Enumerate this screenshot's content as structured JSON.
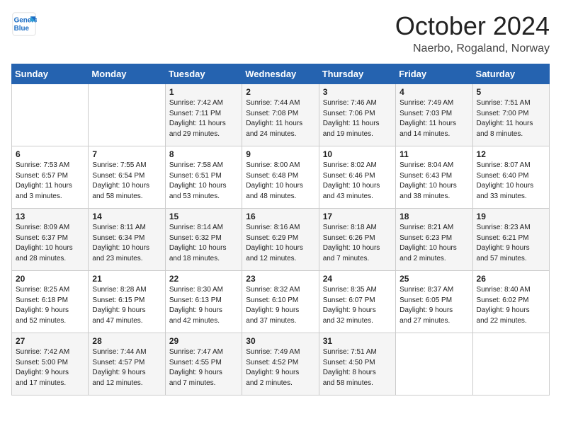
{
  "logo": {
    "line1": "General",
    "line2": "Blue"
  },
  "title": "October 2024",
  "subtitle": "Naerbo, Rogaland, Norway",
  "days_of_week": [
    "Sunday",
    "Monday",
    "Tuesday",
    "Wednesday",
    "Thursday",
    "Friday",
    "Saturday"
  ],
  "weeks": [
    [
      {
        "day": "",
        "detail": ""
      },
      {
        "day": "",
        "detail": ""
      },
      {
        "day": "1",
        "detail": "Sunrise: 7:42 AM\nSunset: 7:11 PM\nDaylight: 11 hours\nand 29 minutes."
      },
      {
        "day": "2",
        "detail": "Sunrise: 7:44 AM\nSunset: 7:08 PM\nDaylight: 11 hours\nand 24 minutes."
      },
      {
        "day": "3",
        "detail": "Sunrise: 7:46 AM\nSunset: 7:06 PM\nDaylight: 11 hours\nand 19 minutes."
      },
      {
        "day": "4",
        "detail": "Sunrise: 7:49 AM\nSunset: 7:03 PM\nDaylight: 11 hours\nand 14 minutes."
      },
      {
        "day": "5",
        "detail": "Sunrise: 7:51 AM\nSunset: 7:00 PM\nDaylight: 11 hours\nand 8 minutes."
      }
    ],
    [
      {
        "day": "6",
        "detail": "Sunrise: 7:53 AM\nSunset: 6:57 PM\nDaylight: 11 hours\nand 3 minutes."
      },
      {
        "day": "7",
        "detail": "Sunrise: 7:55 AM\nSunset: 6:54 PM\nDaylight: 10 hours\nand 58 minutes."
      },
      {
        "day": "8",
        "detail": "Sunrise: 7:58 AM\nSunset: 6:51 PM\nDaylight: 10 hours\nand 53 minutes."
      },
      {
        "day": "9",
        "detail": "Sunrise: 8:00 AM\nSunset: 6:48 PM\nDaylight: 10 hours\nand 48 minutes."
      },
      {
        "day": "10",
        "detail": "Sunrise: 8:02 AM\nSunset: 6:46 PM\nDaylight: 10 hours\nand 43 minutes."
      },
      {
        "day": "11",
        "detail": "Sunrise: 8:04 AM\nSunset: 6:43 PM\nDaylight: 10 hours\nand 38 minutes."
      },
      {
        "day": "12",
        "detail": "Sunrise: 8:07 AM\nSunset: 6:40 PM\nDaylight: 10 hours\nand 33 minutes."
      }
    ],
    [
      {
        "day": "13",
        "detail": "Sunrise: 8:09 AM\nSunset: 6:37 PM\nDaylight: 10 hours\nand 28 minutes."
      },
      {
        "day": "14",
        "detail": "Sunrise: 8:11 AM\nSunset: 6:34 PM\nDaylight: 10 hours\nand 23 minutes."
      },
      {
        "day": "15",
        "detail": "Sunrise: 8:14 AM\nSunset: 6:32 PM\nDaylight: 10 hours\nand 18 minutes."
      },
      {
        "day": "16",
        "detail": "Sunrise: 8:16 AM\nSunset: 6:29 PM\nDaylight: 10 hours\nand 12 minutes."
      },
      {
        "day": "17",
        "detail": "Sunrise: 8:18 AM\nSunset: 6:26 PM\nDaylight: 10 hours\nand 7 minutes."
      },
      {
        "day": "18",
        "detail": "Sunrise: 8:21 AM\nSunset: 6:23 PM\nDaylight: 10 hours\nand 2 minutes."
      },
      {
        "day": "19",
        "detail": "Sunrise: 8:23 AM\nSunset: 6:21 PM\nDaylight: 9 hours\nand 57 minutes."
      }
    ],
    [
      {
        "day": "20",
        "detail": "Sunrise: 8:25 AM\nSunset: 6:18 PM\nDaylight: 9 hours\nand 52 minutes."
      },
      {
        "day": "21",
        "detail": "Sunrise: 8:28 AM\nSunset: 6:15 PM\nDaylight: 9 hours\nand 47 minutes."
      },
      {
        "day": "22",
        "detail": "Sunrise: 8:30 AM\nSunset: 6:13 PM\nDaylight: 9 hours\nand 42 minutes."
      },
      {
        "day": "23",
        "detail": "Sunrise: 8:32 AM\nSunset: 6:10 PM\nDaylight: 9 hours\nand 37 minutes."
      },
      {
        "day": "24",
        "detail": "Sunrise: 8:35 AM\nSunset: 6:07 PM\nDaylight: 9 hours\nand 32 minutes."
      },
      {
        "day": "25",
        "detail": "Sunrise: 8:37 AM\nSunset: 6:05 PM\nDaylight: 9 hours\nand 27 minutes."
      },
      {
        "day": "26",
        "detail": "Sunrise: 8:40 AM\nSunset: 6:02 PM\nDaylight: 9 hours\nand 22 minutes."
      }
    ],
    [
      {
        "day": "27",
        "detail": "Sunrise: 7:42 AM\nSunset: 5:00 PM\nDaylight: 9 hours\nand 17 minutes."
      },
      {
        "day": "28",
        "detail": "Sunrise: 7:44 AM\nSunset: 4:57 PM\nDaylight: 9 hours\nand 12 minutes."
      },
      {
        "day": "29",
        "detail": "Sunrise: 7:47 AM\nSunset: 4:55 PM\nDaylight: 9 hours\nand 7 minutes."
      },
      {
        "day": "30",
        "detail": "Sunrise: 7:49 AM\nSunset: 4:52 PM\nDaylight: 9 hours\nand 2 minutes."
      },
      {
        "day": "31",
        "detail": "Sunrise: 7:51 AM\nSunset: 4:50 PM\nDaylight: 8 hours\nand 58 minutes."
      },
      {
        "day": "",
        "detail": ""
      },
      {
        "day": "",
        "detail": ""
      }
    ]
  ]
}
